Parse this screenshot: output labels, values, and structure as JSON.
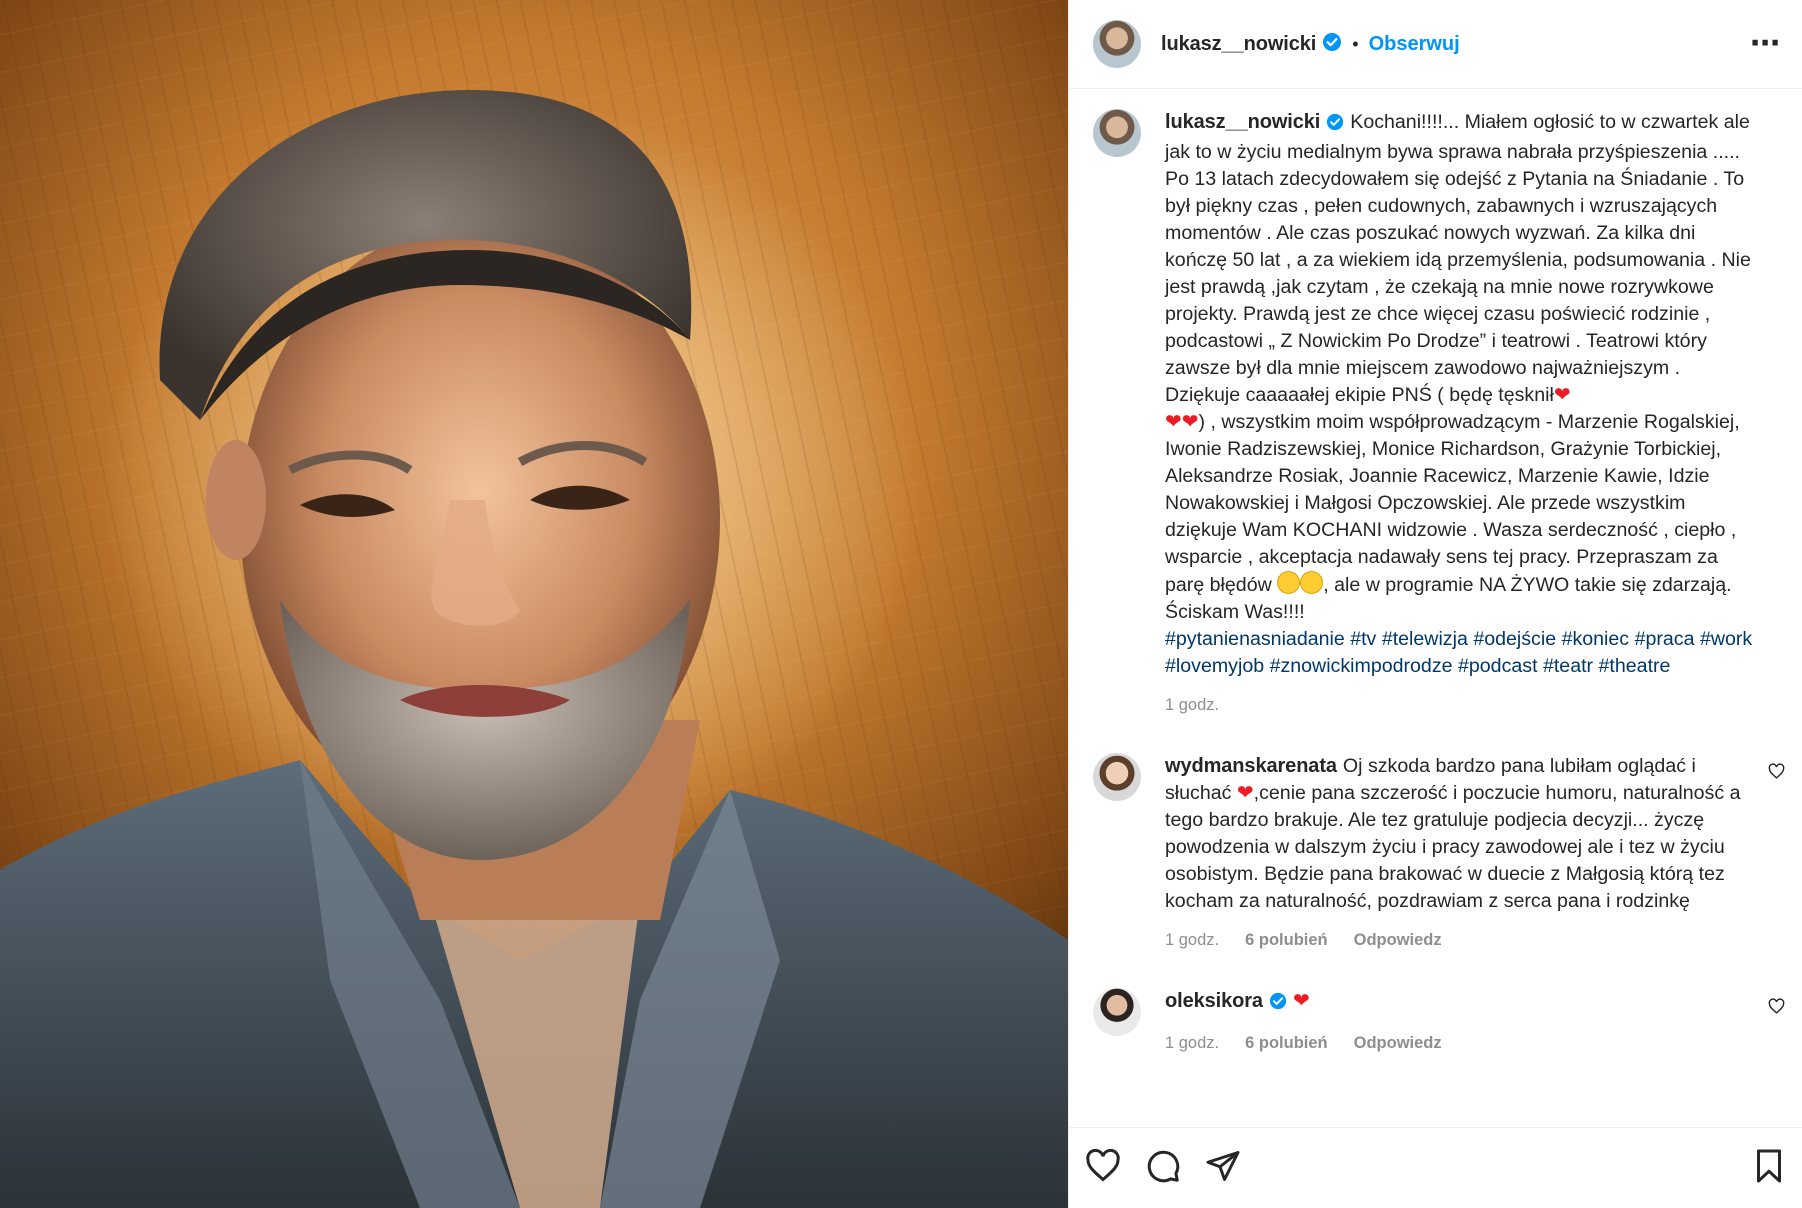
{
  "post": {
    "username": "lukasz__nowicki",
    "follow_label": "Obserwuj",
    "caption": "Kochani!!!!... Miałem ogłosić to w czwartek ale jak to w życiu medialnym bywa sprawa nabrała przyśpieszenia ..... Po 13 latach zdecydowałem się odejść z Pytania na Śniadanie . To był piękny czas , pełen cudownych, zabawnych i wzruszających momentów . Ale czas poszukać nowych wyzwań. Za kilka dni kończę 50 lat , a za wiekiem idą przemyślenia, podsumowania . Nie jest prawdą ,jak czytam , że czekają na mnie nowe rozrywkowe projekty. Prawdą jest ze chce więcej czasu poświecić rodzinie , podcastowi „ Z Nowickim Po Drodze” i teatrowi . Teatrowi który zawsze był dla mnie miejscem zawodowo najważniejszym . Dziękuje caaaaałej ekipie PNŚ ( będę tęsknił",
    "caption_2": ") , wszystkim moim współprowadzącym - Marzenie Rogalskiej, Iwonie Radziszewskiej, Monice Richardson, Grażynie Torbickiej, Aleksandrze Rosiak, Joannie Racewicz, Marzenie Kawie, Idzie Nowakowskiej i Małgosi Opczowskiej. Ale przede wszystkim dziękuje Wam KOCHANI widzowie . Wasza serdeczność , ciepło , wsparcie , akceptacja nadawały sens tej pracy. Przepraszam za parę błędów",
    "caption_3": ", ale w programie NA ŻYWO takie się zdarzają. Ściskam Was!!!!",
    "hashtags": [
      "#pytanienasniadanie",
      "#tv",
      "#telewizja",
      "#odejście",
      "#koniec",
      "#praca",
      "#work",
      "#lovemyjob",
      "#znowickimpodrodze",
      "#podcast",
      "#teatr",
      "#theatre"
    ],
    "time": "1 godz."
  },
  "comments": [
    {
      "username": "wydmanskarenata",
      "text_1": "Oj szkoda bardzo pana lubiłam oglądać i słuchać",
      "text_2": ",cenie pana szczerość i poczucie humoru, naturalność a tego bardzo brakuje. Ale tez gratuluje podjecia decyzji... życzę powodzenia w dalszym życiu i pracy zawodowej ale i tez w życiu osobistym. Będzie pana brakować w duecie z Małgosią którą tez kocham za naturalność, pozdrawiam z serca pana i rodzinkę",
      "time": "1 godz.",
      "likes": "6 polubień",
      "reply": "Odpowiedz"
    },
    {
      "username": "oleksikora",
      "time": "1 godz.",
      "likes": "6 polubień",
      "reply": "Odpowiedz"
    }
  ],
  "icons": [
    "more-icon",
    "verified-icon",
    "heart-icon",
    "comment-icon",
    "share-icon",
    "save-icon"
  ],
  "colors": {
    "link": "#0095f6",
    "hashtag": "#00376b",
    "muted": "#8e8e8e",
    "heart": "#ed1c24"
  }
}
